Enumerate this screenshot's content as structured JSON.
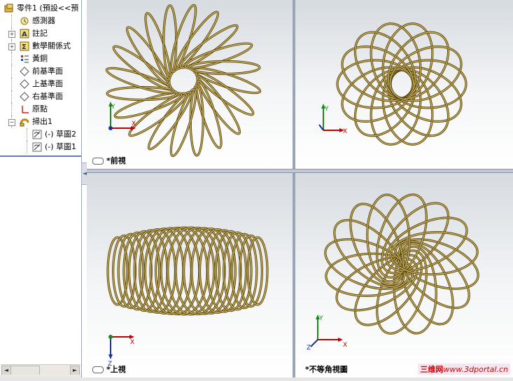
{
  "tree": {
    "items": [
      {
        "label": "零件1 (預設<<預",
        "icon": "part-icon",
        "depth": 0,
        "expander": ""
      },
      {
        "label": "感測器",
        "icon": "sensor-icon",
        "depth": 1,
        "expander": ""
      },
      {
        "label": "註記",
        "icon": "annotation-icon",
        "depth": 1,
        "expander": "+"
      },
      {
        "label": "數學關係式",
        "icon": "equation-icon",
        "depth": 1,
        "expander": "+"
      },
      {
        "label": "黃銅",
        "icon": "material-icon",
        "depth": 1,
        "expander": ""
      },
      {
        "label": "前基準面",
        "icon": "plane-icon",
        "depth": 1,
        "expander": ""
      },
      {
        "label": "上基準面",
        "icon": "plane-icon",
        "depth": 1,
        "expander": ""
      },
      {
        "label": "右基準面",
        "icon": "plane-icon",
        "depth": 1,
        "expander": ""
      },
      {
        "label": "原點",
        "icon": "origin-icon",
        "depth": 1,
        "expander": ""
      },
      {
        "label": "掃出1",
        "icon": "sweep-icon",
        "depth": 1,
        "expander": "−"
      },
      {
        "label": "(-) 草圖2",
        "icon": "sketch-icon",
        "depth": 2,
        "expander": ""
      },
      {
        "label": "(-) 草圖1",
        "icon": "sketch-icon",
        "depth": 2,
        "expander": ""
      }
    ],
    "scroll_left": "◄",
    "scroll_right": "►",
    "collapse": "◄"
  },
  "viewports": {
    "front": {
      "label": "*前視"
    },
    "right": {
      "label": ""
    },
    "top": {
      "label": "*上視"
    },
    "iso": {
      "label": "*不等角視圖"
    }
  },
  "triad": {
    "x": "X",
    "y": "Y",
    "z": "Z"
  },
  "watermark": {
    "cn": "三维网",
    "url": "www.3dportal.cn"
  },
  "colors": {
    "coil": "#5c4a12",
    "coil_highlight": "#d9bf6a",
    "triad_x": "#c00000",
    "triad_y": "#1a8a1a",
    "triad_z": "#1a2fa0"
  }
}
